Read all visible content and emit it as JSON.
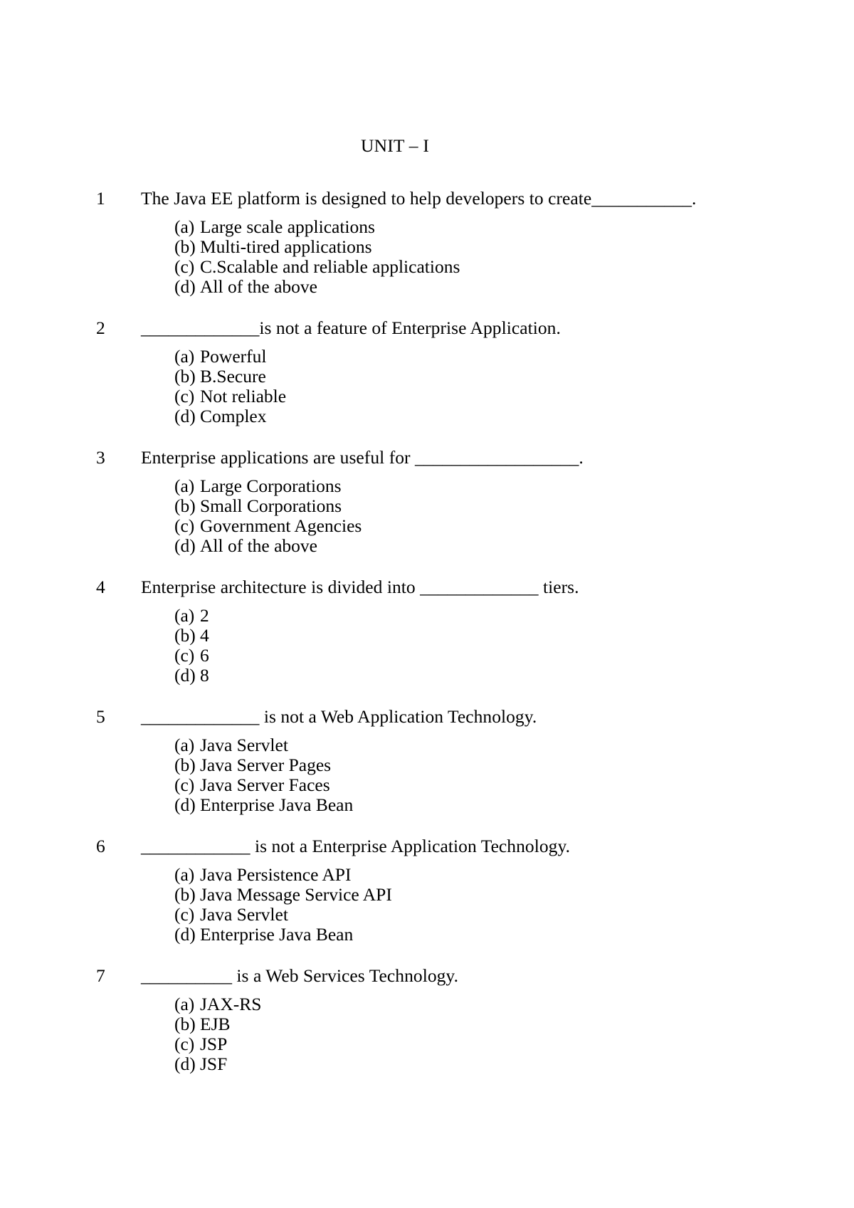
{
  "document": {
    "heading": "UNIT – I",
    "questions": [
      {
        "number": "1",
        "text": "The Java EE platform is designed to help developers to create___________.",
        "options": [
          {
            "marker": "(a)",
            "text": "Large scale applications"
          },
          {
            "marker": "(b)",
            "text": "Multi-tired applications"
          },
          {
            "marker": "(c)",
            "text": "C.Scalable and reliable applications"
          },
          {
            "marker": "(d)",
            "text": "All of the above"
          }
        ]
      },
      {
        "number": "2",
        "text": "_____________is not a feature of Enterprise Application.",
        "options": [
          {
            "marker": "(a)",
            "text": "Powerful"
          },
          {
            "marker": "(b)",
            "text": "B.Secure"
          },
          {
            "marker": "(c)",
            "text": "Not reliable"
          },
          {
            "marker": "(d)",
            "text": "Complex"
          }
        ]
      },
      {
        "number": "3",
        "text": "Enterprise applications are useful for __________________.",
        "options": [
          {
            "marker": "(a)",
            "text": "Large Corporations"
          },
          {
            "marker": "(b)",
            "text": "Small Corporations"
          },
          {
            "marker": "(c)",
            "text": "Government Agencies"
          },
          {
            "marker": "(d)",
            "text": "All of the above"
          }
        ]
      },
      {
        "number": "4",
        "text": "Enterprise architecture is divided into _____________ tiers.",
        "options": [
          {
            "marker": "(a)",
            "text": "2"
          },
          {
            "marker": "(b)",
            "text": "4"
          },
          {
            "marker": "(c)",
            "text": "6"
          },
          {
            "marker": "(d)",
            "text": "8"
          }
        ]
      },
      {
        "number": "5",
        "text": "_____________ is not a Web Application Technology.",
        "options": [
          {
            "marker": "(a)",
            "text": "Java Servlet"
          },
          {
            "marker": "(b)",
            "text": "Java Server Pages"
          },
          {
            "marker": "(c)",
            "text": "Java Server Faces"
          },
          {
            "marker": "(d)",
            "text": "Enterprise Java Bean"
          }
        ]
      },
      {
        "number": "6",
        "text": "____________ is not a Enterprise Application Technology.",
        "options": [
          {
            "marker": "(a)",
            "text": "Java Persistence API"
          },
          {
            "marker": "(b)",
            "text": "Java Message Service API"
          },
          {
            "marker": "(c)",
            "text": "Java Servlet"
          },
          {
            "marker": "(d)",
            "text": "Enterprise Java Bean"
          }
        ]
      },
      {
        "number": "7",
        "text": "__________ is a Web Services Technology.",
        "options": [
          {
            "marker": "(a)",
            "text": "JAX-RS"
          },
          {
            "marker": "(b)",
            "text": "EJB"
          },
          {
            "marker": "(c)",
            "text": "JSP"
          },
          {
            "marker": "(d)",
            "text": "JSF"
          }
        ]
      }
    ]
  }
}
